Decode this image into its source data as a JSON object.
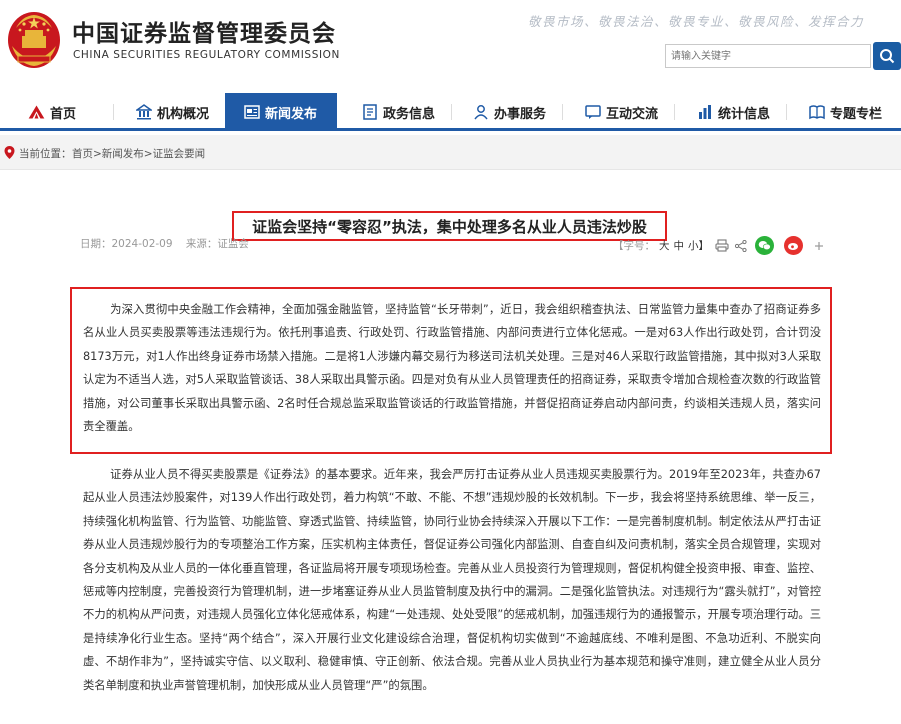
{
  "header": {
    "org_name_cn": "中国证券监督管理委员会",
    "org_name_en": "CHINA SECURITIES REGULATORY COMMISSION",
    "slogan": "敬畏市场、敬畏法治、敬畏专业、敬畏风险、发挥合力",
    "search_placeholder": "请输入关键字"
  },
  "nav": {
    "items": [
      {
        "label": "首页",
        "icon": "home-icon"
      },
      {
        "label": "机构概况",
        "icon": "building-icon"
      },
      {
        "label": "新闻发布",
        "icon": "news-icon",
        "active": true
      },
      {
        "label": "政务信息",
        "icon": "document-icon"
      },
      {
        "label": "办事服务",
        "icon": "service-icon"
      },
      {
        "label": "互动交流",
        "icon": "chat-icon"
      },
      {
        "label": "统计信息",
        "icon": "chart-icon"
      },
      {
        "label": "专题专栏",
        "icon": "book-icon"
      }
    ]
  },
  "breadcrumb": {
    "label": "当前位置：",
    "path": "首页>新闻发布>证监会要闻"
  },
  "article": {
    "title": "证监会坚持“零容忍”执法，集中处理多名从业人员违法炒股",
    "date": "日期：2024-02-09",
    "source": "来源：证监会",
    "font_size_label": "【字号：",
    "font_large": "大",
    "font_medium": "中",
    "font_small": "小】",
    "paragraph1": "为深入贯彻中央金融工作会精神，全面加强金融监管，坚持监管“长牙带刺”，近日，我会组织稽查执法、日常监管力量集中查办了招商证券多名从业人员买卖股票等违法违规行为。依托刑事追责、行政处罚、行政监管措施、内部问责进行立体化惩戒。一是对63人作出行政处罚，合计罚没8173万元，对1人作出终身证券市场禁入措施。二是将1人涉嫌内幕交易行为移送司法机关处理。三是对46人采取行政监管措施，其中拟对3人采取认定为不适当人选，对5人采取监管谈话、38人采取出具警示函。四是对负有从业人员管理责任的招商证券，采取责令增加合规检查次数的行政监管措施，对公司董事长采取出具警示函、2名时任合规总监采取监管谈话的行政监管措施，并督促招商证券启动内部问责，约谈相关违规人员，落实问责全覆盖。",
    "paragraph2": "证券从业人员不得买卖股票是《证券法》的基本要求。近年来，我会严厉打击证券从业人员违规买卖股票行为。2019年至2023年，共查办67起从业人员违法炒股案件，对139人作出行政处罚，着力构筑“不敢、不能、不想”违规炒股的长效机制。下一步，我会将坚持系统思维、举一反三，持续强化机构监管、行为监管、功能监管、穿透式监管、持续监管，协同行业协会持续深入开展以下工作：一是完善制度机制。制定依法从严打击证券从业人员违规炒股行为的专项整治工作方案，压实机构主体责任，督促证券公司强化内部监测、自查自纠及问责机制，落实全员合规管理，实现对各分支机构及从业人员的一体化垂直管理，各证监局将开展专项现场检查。完善从业人员投资行为管理规则，督促机构健全投资申报、审查、监控、惩戒等内控制度，完善投资行为管理机制，进一步堵塞证券从业人员监管制度及执行中的漏洞。二是强化监管执法。对违规行为“露头就打”，对管控不力的机构从严问责，对违规人员强化立体化惩戒体系，构建“一处违规、处处受限”的惩戒机制，加强违规行为的通报警示，开展专项治理行动。三是持续净化行业生态。坚持“两个结合”，深入开展行业文化建设综合治理，督促机构切实做到“不逾越底线、不唯利是图、不急功近利、不脱实向虚、不胡作非为”，坚持诚实守信、以义取利、稳健审慎、守正创新、依法合规。完善从业人员执业行为基本规范和操守准则，建立健全从业人员分类名单制度和执业声誉管理机制，加快形成从业人员管理“严”的氛围。"
  },
  "colors": {
    "nav_active": "#1f5aa6",
    "highlight_border": "#e02020",
    "search_button": "#1a5ca3"
  }
}
